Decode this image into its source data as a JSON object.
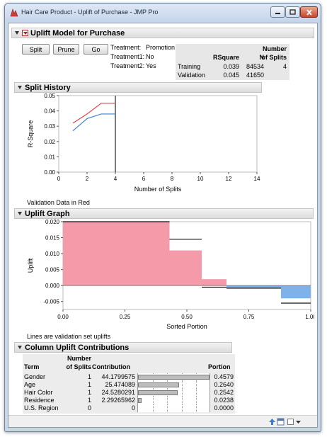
{
  "window": {
    "title": "Hair Care Product - Uplift of Purchase - JMP Pro"
  },
  "report": {
    "title": "Uplift Model for Purchase",
    "buttons": {
      "split": "Split",
      "prune": "Prune",
      "go": "Go"
    },
    "treatment": {
      "treatment_label": "Treatment:",
      "treatment_value": "Promotion",
      "treatment1_label": "Treatment1:",
      "treatment1_value": "No",
      "treatment2_label": "Treatment2:",
      "treatment2_value": "Yes"
    },
    "stats_table": {
      "headers": {
        "rsquare": "RSquare",
        "n": "N",
        "splits_line1": "Number",
        "splits_line2": "of Splits"
      },
      "rows": [
        {
          "label": "Training",
          "rsquare": "0.039",
          "n": "84534",
          "splits": "4"
        },
        {
          "label": "Validation",
          "rsquare": "0.045",
          "n": "41650",
          "splits": ""
        }
      ]
    }
  },
  "split_history": {
    "title": "Split History",
    "note": "Validation Data in Red",
    "chart_data": {
      "type": "line",
      "xlabel": "Number of Splits",
      "ylabel": "R-Square",
      "xlim": [
        0,
        14
      ],
      "ylim": [
        0,
        0.05
      ],
      "x_ticks": [
        "0",
        "2",
        "4",
        "6",
        "8",
        "10",
        "12",
        "14"
      ],
      "y_ticks": [
        "0.00",
        "0.01",
        "0.02",
        "0.03",
        "0.04",
        "0.05"
      ],
      "vertical_line_x": 4,
      "series": [
        {
          "color": "#e2424a",
          "x": [
            1,
            2,
            3,
            4
          ],
          "y": [
            0.032,
            0.038,
            0.045,
            0.045
          ]
        },
        {
          "color": "#3f7fd6",
          "x": [
            1,
            2,
            3,
            4
          ],
          "y": [
            0.027,
            0.035,
            0.038,
            0.038
          ]
        }
      ]
    }
  },
  "uplift_graph": {
    "title": "Uplift Graph",
    "note": "Lines are validation set uplifts",
    "chart_data": {
      "type": "bar",
      "xlabel": "Sorted Portion",
      "ylabel": "Uplift",
      "xlim": [
        0,
        1
      ],
      "ylim": [
        -0.0075,
        0.02
      ],
      "x_ticks": [
        "0.00",
        "0.25",
        "0.50",
        "0.75",
        "1.00"
      ],
      "y_ticks": [
        "0.020",
        "0.015",
        "0.010",
        "0.005",
        "0.000",
        "-0.005"
      ],
      "bars": [
        {
          "start": 0.0,
          "end": 0.43,
          "value": 0.02,
          "color": "#f59aa8",
          "validation": 0.02
        },
        {
          "start": 0.43,
          "end": 0.56,
          "value": 0.011,
          "color": "#f59aa8",
          "validation": 0.0145
        },
        {
          "start": 0.56,
          "end": 0.66,
          "value": 0.002,
          "color": "#f59aa8",
          "validation": -0.0005
        },
        {
          "start": 0.66,
          "end": 0.88,
          "value": -0.001,
          "color": "#7fb2ea",
          "validation": -0.0008
        },
        {
          "start": 0.88,
          "end": 1.0,
          "value": -0.004,
          "color": "#7fb2ea",
          "validation": -0.0055
        }
      ]
    }
  },
  "contributions": {
    "title": "Column Uplift Contributions",
    "headers": {
      "term": "Term",
      "splits_line1": "Number",
      "splits_line2": "of Splits",
      "contribution": "Contribution",
      "portion": "Portion"
    },
    "rows": [
      {
        "term": "Gender",
        "splits": "1",
        "contribution": "44.1799575",
        "portion": "0.4579",
        "fraction": 0.4579
      },
      {
        "term": "Age",
        "splits": "1",
        "contribution": "25.474089",
        "portion": "0.2640",
        "fraction": 0.264
      },
      {
        "term": "Hair Color",
        "splits": "1",
        "contribution": "24.5280291",
        "portion": "0.2542",
        "fraction": 0.2542
      },
      {
        "term": "Residence",
        "splits": "1",
        "contribution": "2.29265962",
        "portion": "0.0238",
        "fraction": 0.0238
      },
      {
        "term": "U.S. Region",
        "splits": "0",
        "contribution": "0",
        "portion": "0.0000",
        "fraction": 0.0
      }
    ]
  }
}
